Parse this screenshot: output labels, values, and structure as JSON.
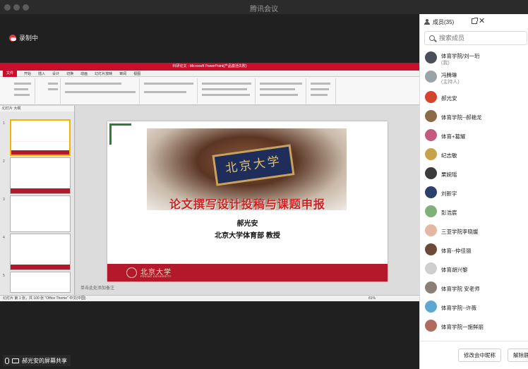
{
  "window": {
    "title": "腾讯会议"
  },
  "recording": {
    "label": "录制中"
  },
  "presentation": {
    "window_title": "科研论文 - Microsoft PowerPoint(产品激活失败)",
    "tabs": [
      "文件",
      "开始",
      "插入",
      "设计",
      "切换",
      "动画",
      "幻灯片放映",
      "审阅",
      "视图"
    ],
    "side_tabs": "幻灯片 大纲",
    "notes_placeholder": "单击此处添加备注",
    "status": "幻灯片 第 1 张，共 100 张   \"Office Theme\"   中文(中国)",
    "zoom": "81%",
    "slide": {
      "title": "论文撰写设计投稿与课题申报",
      "author": "郝光安",
      "affiliation": "北京大学体育部 教授",
      "banner_text": "北京大学",
      "logo_text": "北京大学",
      "logo_sub": "PEKING UNIVERSITY"
    },
    "thumb_numbers": [
      "1",
      "2",
      "3",
      "4",
      "5"
    ]
  },
  "screen_share": {
    "label": "郝光安的屏幕共享"
  },
  "members_panel": {
    "title": "成员(35)",
    "search_placeholder": "搜索成员",
    "members": [
      {
        "name": "体育学院/刘一珩",
        "sub": "(我)",
        "avatar_color": "#4a4f57"
      },
      {
        "name": "冯腾琳",
        "sub": "(主持人)",
        "avatar_color": "#9aa3a8"
      },
      {
        "name": "郝光安",
        "sub": "",
        "avatar_color": "#d4442c"
      },
      {
        "name": "体育学院--郝艳龙",
        "sub": "",
        "avatar_color": "#8a6a48"
      },
      {
        "name": "体育+葛耀",
        "sub": "",
        "avatar_color": "#c45a7e"
      },
      {
        "name": "纪志敏",
        "sub": "",
        "avatar_color": "#c8a24a"
      },
      {
        "name": "栗婉瑶",
        "sub": "",
        "avatar_color": "#3b3b3b"
      },
      {
        "name": "刘新宇",
        "sub": "",
        "avatar_color": "#2d3f6b"
      },
      {
        "name": "彭浩宸",
        "sub": "",
        "avatar_color": "#7fb07a"
      },
      {
        "name": "三亚学院李晓媛",
        "sub": "",
        "avatar_color": "#e3b7a3"
      },
      {
        "name": "体育--仲佳丽",
        "sub": "",
        "avatar_color": "#6b4a3a"
      },
      {
        "name": "体育胡兴黎",
        "sub": "",
        "avatar_color": "#cfcfcf"
      },
      {
        "name": "体育学院 安老师",
        "sub": "",
        "avatar_color": "#8c7f78"
      },
      {
        "name": "体育学院--许薇",
        "sub": "",
        "avatar_color": "#5ea7cf"
      },
      {
        "name": "体育学院一施鲜丽",
        "sub": "",
        "avatar_color": "#b06b5e"
      }
    ],
    "rename_button": "修改会中昵称",
    "unmute_button": "解除静音"
  }
}
